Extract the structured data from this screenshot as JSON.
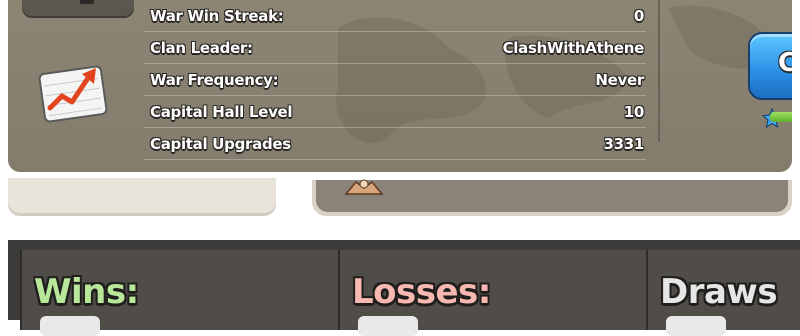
{
  "info_panel": {
    "right_top_label": "",
    "rows": [
      {
        "label": "War Win Streak:",
        "value": "0"
      },
      {
        "label": "Clan Leader:",
        "value": "ClashWithAthene"
      },
      {
        "label": "War Frequency:",
        "value": "Never"
      },
      {
        "label": "Capital Hall Level",
        "value": "10"
      },
      {
        "label": "Capital Upgrades",
        "value": "3331"
      }
    ],
    "button_label": "C",
    "progress_fraction": 0.75
  },
  "results": {
    "wins_label": "Wins:",
    "losses_label": "Losses:",
    "draws_label": "Draws",
    "colors": {
      "wins": "#b8e79a",
      "losses": "#f6b8b0",
      "draws": "#e6e6e6"
    }
  },
  "icons": {
    "chart": "chart-up-icon",
    "badge": "clan-badge-icon",
    "xp": "xp-star-icon"
  }
}
